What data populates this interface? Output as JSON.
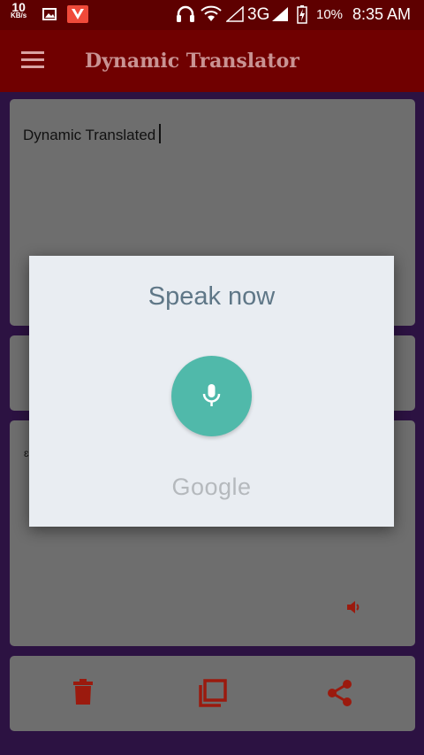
{
  "status_bar": {
    "speed_value": "10",
    "speed_unit": "KB/s",
    "network": "3G",
    "battery": "10%",
    "time": "8:35 AM",
    "icons": [
      "image-icon",
      "v-app-icon",
      "headset-icon",
      "wifi-icon",
      "signal-icon",
      "battery-charging-icon"
    ]
  },
  "app_bar": {
    "title": "Dynamic Translator",
    "menu_icon": "hamburger-menu-icon"
  },
  "input_card": {
    "text": "Dynamic Translated"
  },
  "output_card": {
    "visible_mark": "ɛ",
    "speaker_icon": "speaker-icon"
  },
  "actions": {
    "icons": [
      "delete-icon",
      "copy-icon",
      "share-icon"
    ]
  },
  "colors": {
    "status_bar": "#5e0000",
    "app_bar": "#700000",
    "accent_red": "#9b1a0e",
    "mic_teal": "#50b9aa",
    "dialog_bg": "#e9edf2"
  },
  "voice_dialog": {
    "prompt": "Speak now",
    "brand": "Google",
    "mic_icon": "microphone-icon"
  }
}
